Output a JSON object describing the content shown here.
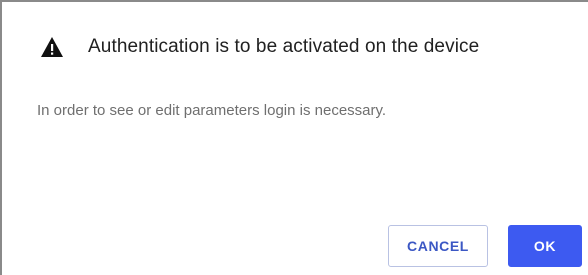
{
  "dialog": {
    "title": "Authentication is to be activated on the device",
    "message": "In order to see or edit parameters login is necessary.",
    "icon": "warning-icon",
    "cancel_label": "CANCEL",
    "ok_label": "OK"
  },
  "colors": {
    "primary": "#3d5af1",
    "cancel_text": "#3b57c4",
    "title_text": "#212121",
    "message_text": "#6f6f6f"
  }
}
